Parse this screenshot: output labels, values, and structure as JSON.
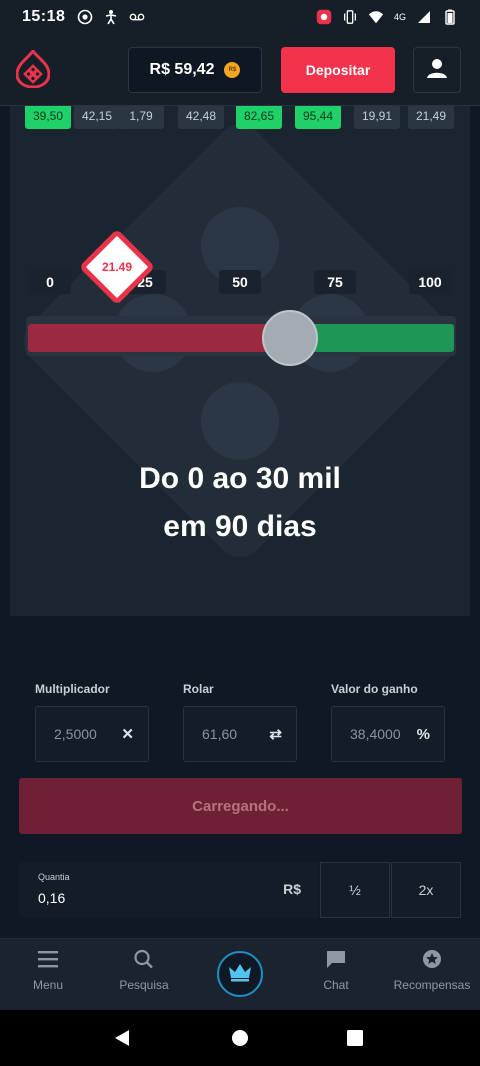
{
  "status": {
    "time": "15:18",
    "network": "4G"
  },
  "header": {
    "balance": "R$ 59,42",
    "coin_label": "R$",
    "deposit_label": "Depositar"
  },
  "history": [
    "39,50",
    "42,15",
    "1,79",
    "42,48",
    "82,65",
    "95,44",
    "19,91",
    "21,49"
  ],
  "history_win": [
    true,
    false,
    false,
    false,
    true,
    true,
    false,
    false
  ],
  "scale": {
    "m0": "0",
    "m25": "25",
    "m50": "50",
    "m75": "75",
    "m100": "100"
  },
  "result": {
    "value": "21.49"
  },
  "slider": {
    "roll_value": 61.6
  },
  "overlay": {
    "line1": "Do 0 ao 30 mil",
    "line2": "em 90 dias"
  },
  "controls": {
    "multiplier_label": "Multiplicador",
    "multiplier_value": "2,5000",
    "multiplier_suffix": "✕",
    "roll_label": "Rolar",
    "roll_value": "61,60",
    "roll_suffix": "⇄",
    "win_label": "Valor do ganho",
    "win_value": "38,4000",
    "win_suffix": "%"
  },
  "bet": {
    "loading_label": "Carregando...",
    "qty_label": "Quantia",
    "qty_value": "0,16",
    "currency": "R$",
    "half_label": "½",
    "double_label": "2x"
  },
  "tabs": {
    "menu": "Menu",
    "search": "Pesquisa",
    "chat": "Chat",
    "rewards": "Recompensas"
  }
}
